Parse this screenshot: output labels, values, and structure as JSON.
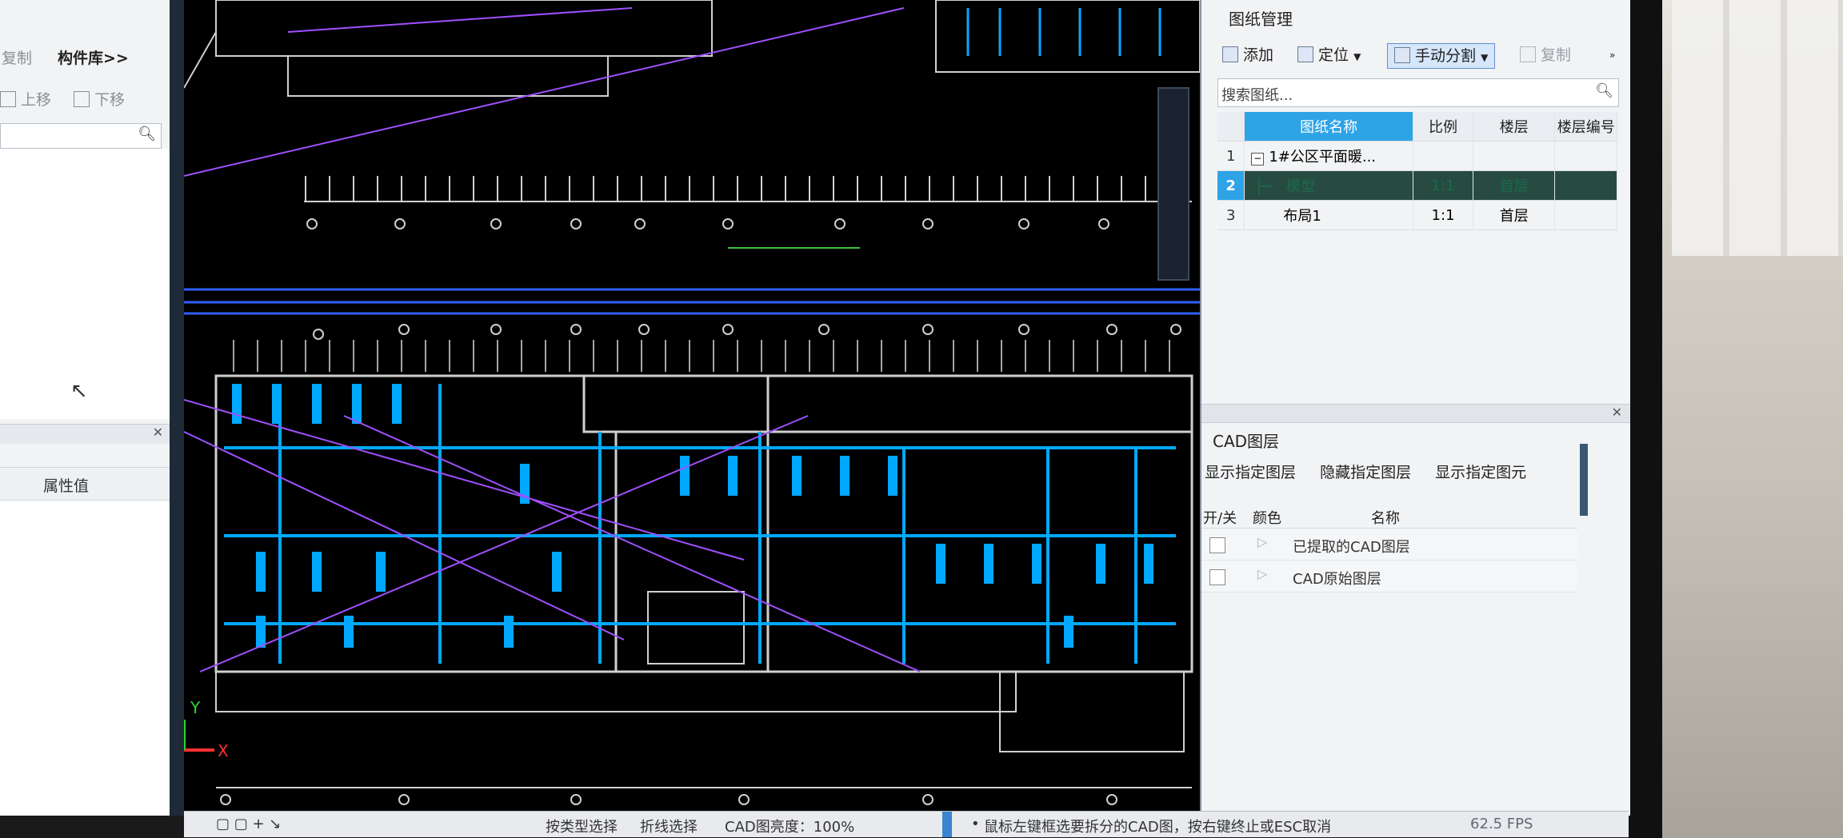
{
  "left_panel": {
    "copy_label": "复制",
    "library_label": "构件库>>",
    "move_up_label": "上移",
    "move_down_label": "下移",
    "property_value_header": "属性值"
  },
  "drawing_manager": {
    "title": "图纸管理",
    "toolbar": {
      "add": "添加",
      "locate": "定位",
      "manual_split": "手动分割",
      "copy": "复制"
    },
    "search_placeholder": "搜索图纸...",
    "columns": [
      "图纸名称",
      "比例",
      "楼层",
      "楼层编号"
    ],
    "rows": [
      {
        "index": "1",
        "name": "1#公区平面暖...",
        "ratio": "",
        "floor": "",
        "code": ""
      },
      {
        "index": "2",
        "name": "模型",
        "ratio": "1:1",
        "floor": "首层",
        "code": ""
      },
      {
        "index": "3",
        "name": "布局1",
        "ratio": "1:1",
        "floor": "首层",
        "code": ""
      }
    ]
  },
  "cad_layers": {
    "title": "CAD图层",
    "actions": [
      "显示指定图层",
      "隐藏指定图层",
      "显示指定图元"
    ],
    "columns": [
      "开/关",
      "颜色",
      "名称"
    ],
    "rows": [
      {
        "name": "已提取的CAD图层"
      },
      {
        "name": "CAD原始图层"
      }
    ]
  },
  "canvas": {
    "axis_y": "Y",
    "axis_x": "X"
  },
  "status_bar": {
    "type_select": "按类型选择",
    "polyline_select": "折线选择",
    "brightness": "CAD图亮度：100%",
    "hint": "鼠标左键框选要拆分的CAD图，按右键终止或ESC取消",
    "fps": "62.5 FPS"
  },
  "colors": {
    "selection_blue": "#2ea3e6",
    "cad_background": "#000000",
    "cad_cyan": "#00a8ff",
    "cad_purple": "#a050ff"
  }
}
